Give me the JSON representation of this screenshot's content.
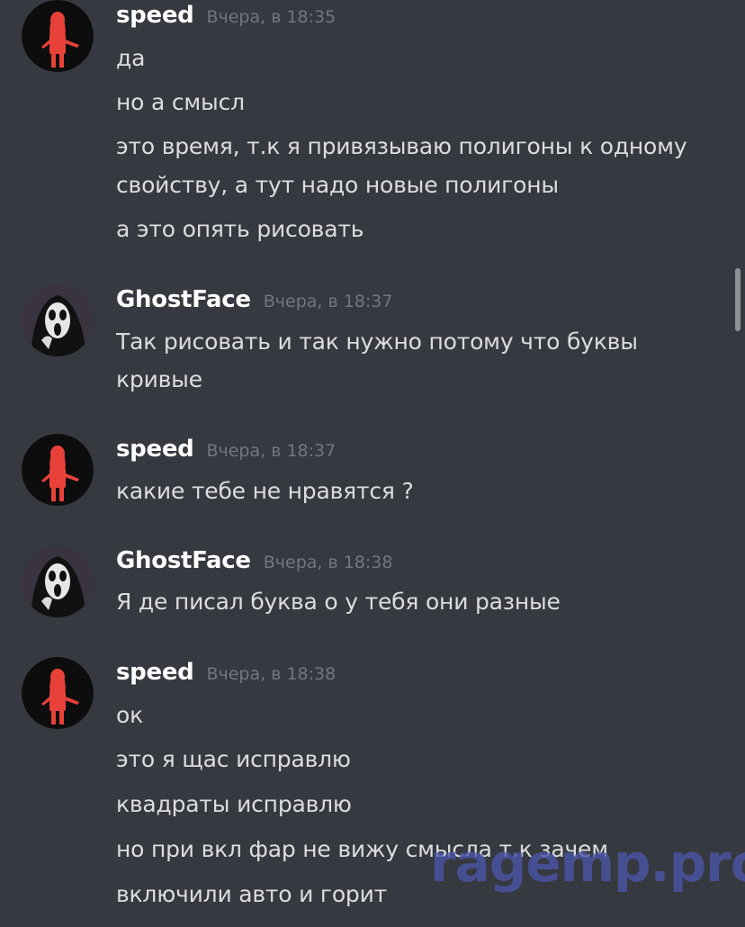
{
  "messages": [
    {
      "user": "speed",
      "time": "Вчера, в 18:35",
      "avatar_icon": "red-silhouette-avatar-icon",
      "lines": [
        "да",
        "но а смысл",
        "это время, т.к я привязываю полигоны к одному",
        "свойству, а тут надо новые полигоны",
        "а это опять рисовать"
      ]
    },
    {
      "user": "GhostFace",
      "time": "Вчера, в 18:37",
      "avatar_icon": "ghostface-mask-avatar-icon",
      "lines": [
        "Так рисовать и так нужно потому что буквы",
        "кривые"
      ]
    },
    {
      "user": "speed",
      "time": "Вчера, в 18:37",
      "avatar_icon": "red-silhouette-avatar-icon",
      "lines": [
        "какие тебе не нравятся ?"
      ]
    },
    {
      "user": "GhostFace",
      "time": "Вчера, в 18:38",
      "avatar_icon": "ghostface-mask-avatar-icon",
      "lines": [
        "Я де писал буква о у тебя они разные"
      ]
    },
    {
      "user": "speed",
      "time": "Вчера, в 18:38",
      "avatar_icon": "red-silhouette-avatar-icon",
      "lines": [
        "ок",
        "это я щас исправлю",
        "квадраты исправлю",
        "но при вкл фар не вижу смысла т.к зачем",
        "включили авто и горит"
      ]
    }
  ],
  "watermark": "ragemp.pro",
  "colors": {
    "background": "#36393f",
    "username": "#ffffff",
    "timestamp": "#72767d",
    "message_text": "#dcddde",
    "scrollbar": "#8e9297",
    "avatar_red": "#e8413a"
  }
}
